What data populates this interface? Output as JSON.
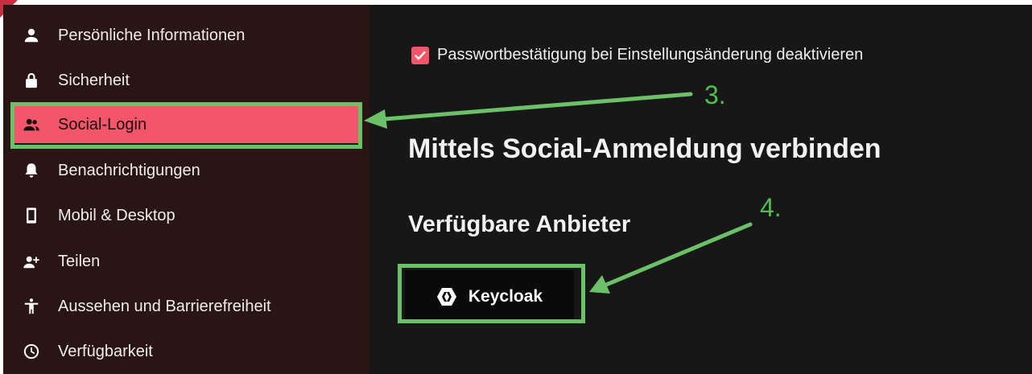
{
  "sidebar": {
    "items": [
      {
        "label": "Persönliche Informationen",
        "icon": "person-icon",
        "active": false
      },
      {
        "label": "Sicherheit",
        "icon": "lock-icon",
        "active": false
      },
      {
        "label": "Social-Login",
        "icon": "people-icon",
        "active": true
      },
      {
        "label": "Benachrichtigungen",
        "icon": "bell-icon",
        "active": false
      },
      {
        "label": "Mobil & Desktop",
        "icon": "phone-icon",
        "active": false
      },
      {
        "label": "Teilen",
        "icon": "person-add-icon",
        "active": false
      },
      {
        "label": "Aussehen und Barrierefreiheit",
        "icon": "accessibility-icon",
        "active": false
      },
      {
        "label": "Verfügbarkeit",
        "icon": "clock-icon",
        "active": false
      }
    ]
  },
  "main": {
    "password_checkbox": {
      "label": "Passwortbestätigung bei Einstellungsänderung deaktivieren",
      "checked": true
    },
    "heading": "Mittels Social-Anmeldung verbinden",
    "subheading": "Verfügbare Anbieter",
    "provider_button": {
      "label": "Keycloak",
      "icon": "keycloak-icon"
    }
  },
  "annotations": {
    "step3": "3.",
    "step4": "4."
  },
  "colors": {
    "accent": "#f3566a",
    "annotation": "#6cc067",
    "sidebar_bg": "#2a1516",
    "main_bg": "#171717"
  }
}
